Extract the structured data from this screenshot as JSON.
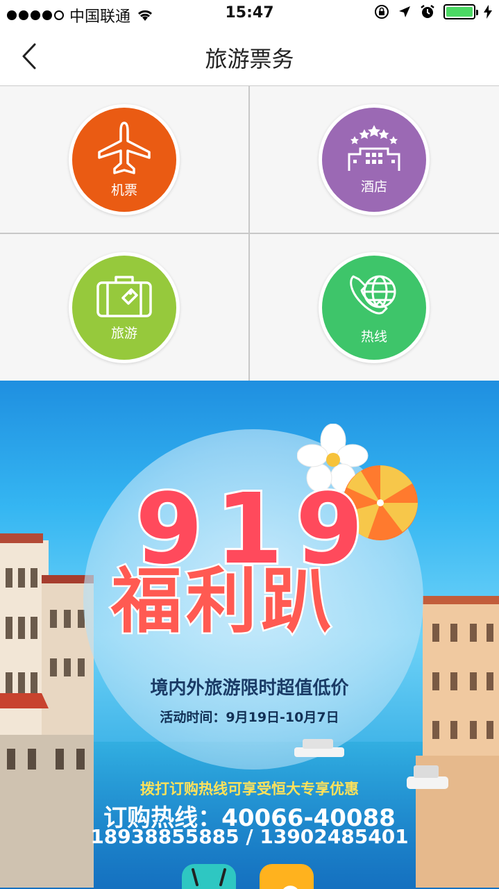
{
  "status_bar": {
    "carrier": "中国联通",
    "time": "15:47",
    "signal_dots_filled": 4,
    "signal_dots_total": 5,
    "battery_level": 1.0,
    "battery_color": "#4cd964"
  },
  "nav": {
    "title": "旅游票务",
    "back_icon": "chevron-left-icon"
  },
  "services": [
    {
      "label": "机票",
      "icon": "airplane-icon",
      "color": "#ea5b13"
    },
    {
      "label": "酒店",
      "icon": "hotel-icon",
      "color": "#9b69b4"
    },
    {
      "label": "旅游",
      "icon": "suitcase-icon",
      "color": "#96c93c"
    },
    {
      "label": "热线",
      "icon": "phone-globe-icon",
      "color": "#3ec56a"
    }
  ],
  "banner": {
    "headline_number": "919",
    "headline_text": "福利趴",
    "subtitle": "境内外旅游限时超值低价",
    "period": "活动时间：9月19日-10月7日",
    "promo": "拨打订购热线可享受恒大专享优惠",
    "hotline": "订购热线：40066-40088",
    "phones": "18938855885 / 13902485401"
  }
}
